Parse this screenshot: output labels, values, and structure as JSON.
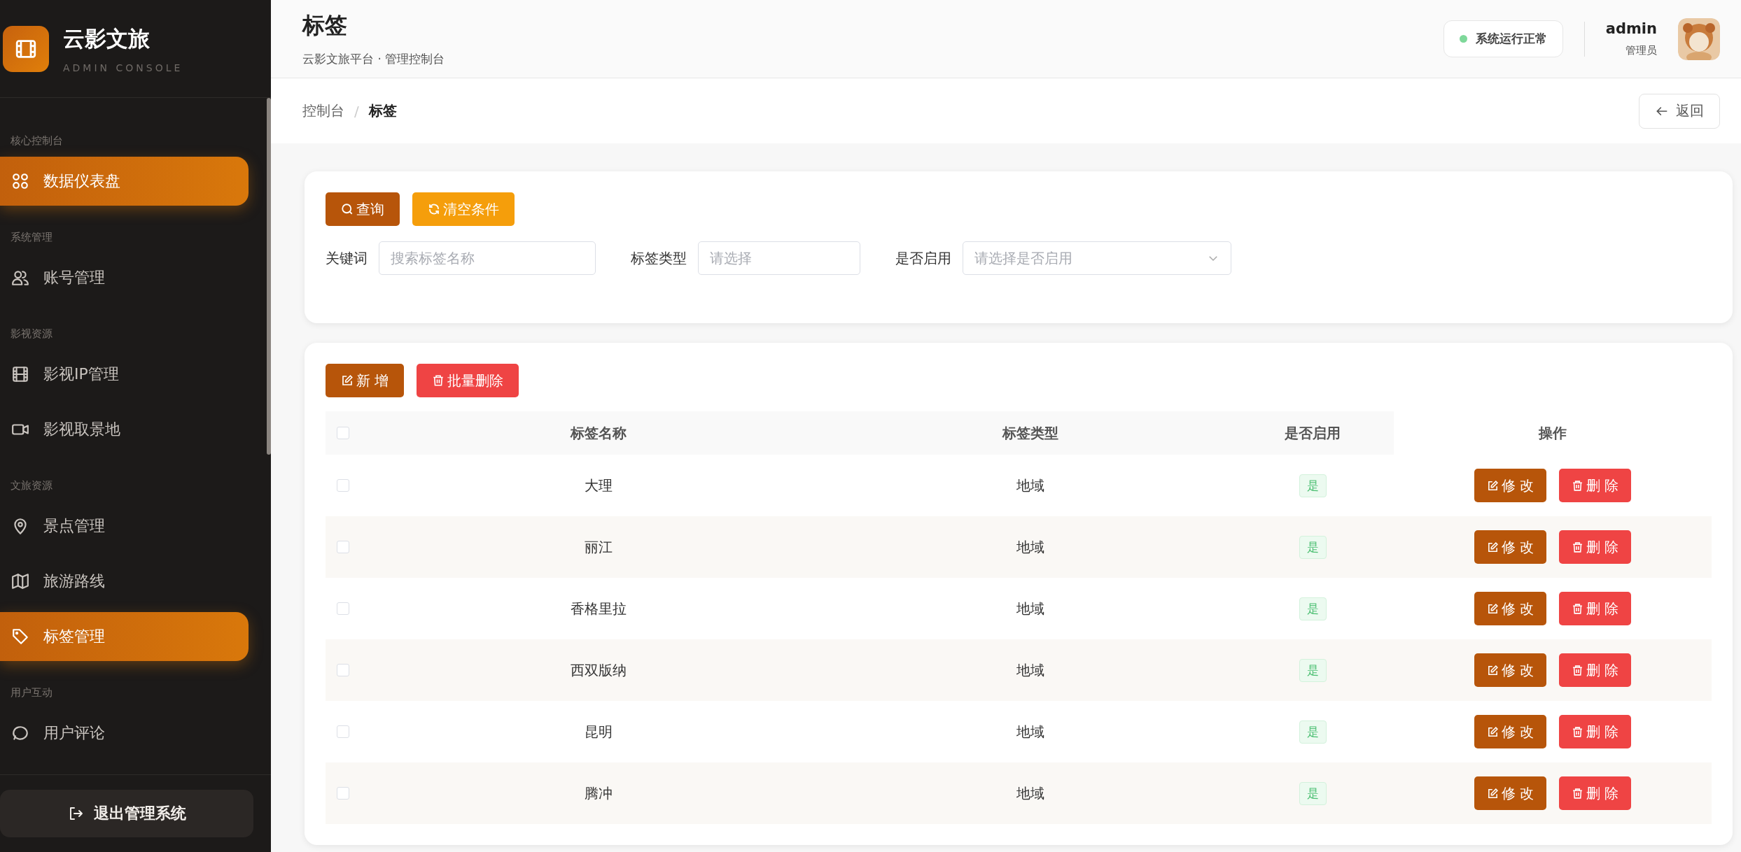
{
  "brand": {
    "title": "云影文旅",
    "subtitle": "ADMIN CONSOLE"
  },
  "sidebar": {
    "groups": [
      {
        "label": "核心控制台",
        "items": [
          {
            "label": "数据仪表盘",
            "kind": "grid",
            "selected": true
          }
        ]
      },
      {
        "label": "系统管理",
        "items": [
          {
            "label": "账号管理",
            "kind": "users",
            "selected": false
          }
        ]
      },
      {
        "label": "影视资源",
        "items": [
          {
            "label": "影视IP管理",
            "kind": "film",
            "selected": false
          },
          {
            "label": "影视取景地",
            "kind": "video",
            "selected": false
          }
        ]
      },
      {
        "label": "文旅资源",
        "items": [
          {
            "label": "景点管理",
            "kind": "pin",
            "selected": false
          },
          {
            "label": "旅游路线",
            "kind": "map",
            "selected": false
          },
          {
            "label": "标签管理",
            "kind": "tag",
            "selected": true
          }
        ]
      },
      {
        "label": "用户互动",
        "items": [
          {
            "label": "用户评论",
            "kind": "chat",
            "selected": false
          }
        ]
      }
    ],
    "logout": "退出管理系统"
  },
  "header": {
    "title": "标签",
    "subtitle": "云影文旅平台 · 管理控制台",
    "status": "系统运行正常",
    "user": "admin",
    "role": "管理员"
  },
  "breadcrumb": [
    "控制台",
    "/",
    "标签"
  ],
  "back_button": "返回",
  "filters": {
    "search_button": "查询",
    "clear_button": "清空条件",
    "fields": [
      {
        "label": "关键词",
        "placeholder": "搜索标签名称",
        "kind": "text"
      },
      {
        "label": "标签类型",
        "placeholder": "请选择",
        "kind": "text"
      },
      {
        "label": "是否启用",
        "placeholder": "请选择是否启用",
        "kind": "select"
      }
    ]
  },
  "toolbar": {
    "add_button": "新 增",
    "batch_delete_button": "批量删除"
  },
  "table": {
    "select_all_checked": false,
    "columns": [
      "标签名称",
      "标签类型",
      "是否启用",
      "操作"
    ],
    "rows": [
      {
        "name": "大理",
        "type": "地域",
        "enabled": "是",
        "checked": false,
        "edit": "修 改",
        "delete": "删 除"
      },
      {
        "name": "丽江",
        "type": "地域",
        "enabled": "是",
        "checked": false,
        "edit": "修 改",
        "delete": "删 除"
      },
      {
        "name": "香格里拉",
        "type": "地域",
        "enabled": "是",
        "checked": false,
        "edit": "修 改",
        "delete": "删 除"
      },
      {
        "name": "西双版纳",
        "type": "地域",
        "enabled": "是",
        "checked": false,
        "edit": "修 改",
        "delete": "删 除"
      },
      {
        "name": "昆明",
        "type": "地域",
        "enabled": "是",
        "checked": false,
        "edit": "修 改",
        "delete": "删 除"
      },
      {
        "name": "腾冲",
        "type": "地域",
        "enabled": "是",
        "checked": false,
        "edit": "修 改",
        "delete": "删 除"
      }
    ]
  }
}
